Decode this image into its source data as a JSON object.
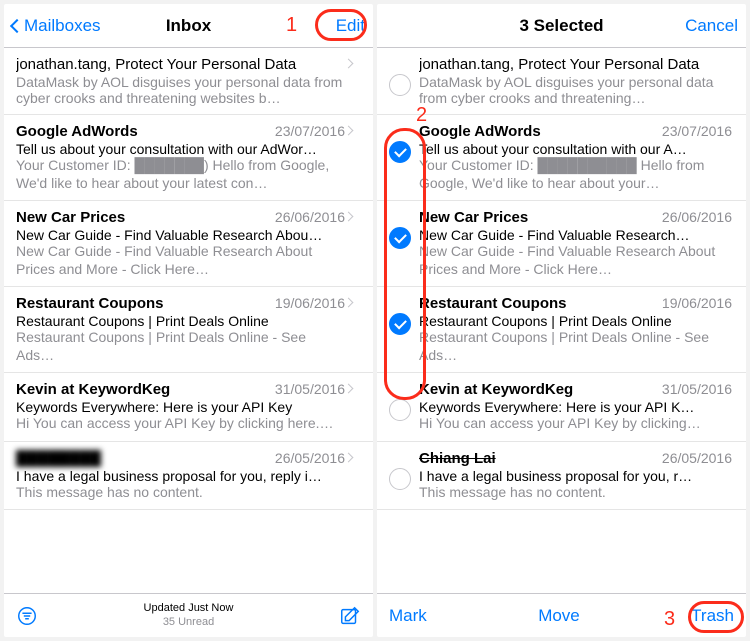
{
  "left": {
    "back_label": "Mailboxes",
    "title": "Inbox",
    "edit_label": "Edit",
    "status_line1": "Updated Just Now",
    "status_line2": "35 Unread",
    "messages": [
      {
        "sender": "jonathan.tang, Protect Your Personal Data",
        "sender_weight": "normal",
        "date": "",
        "subject": "DataMask by AOL disguises your personal data from cyber crooks and threatening websites b…",
        "preview": ""
      },
      {
        "sender": "Google AdWords",
        "date": "23/07/2016",
        "subject": "Tell us about your consultation with our AdWor…",
        "preview": "Your Customer ID: ███████) Hello from Google, We'd like to hear about your latest con…",
        "mask": true
      },
      {
        "sender": "New Car Prices",
        "date": "26/06/2016",
        "subject": "New Car Guide - Find Valuable Research Abou…",
        "preview": "New Car Guide - Find Valuable Research About Prices and More - Click Here…"
      },
      {
        "sender": "Restaurant Coupons",
        "date": "19/06/2016",
        "subject": "Restaurant Coupons | Print Deals Online",
        "preview": "Restaurant Coupons | Print Deals Online - See Ads…"
      },
      {
        "sender": "Kevin at KeywordKeg",
        "date": "31/05/2016",
        "subject": "Keywords Everywhere: Here is your API Key",
        "preview": "Hi\nYou can access your API Key by clicking here.…"
      },
      {
        "sender": "████████",
        "date": "26/05/2016",
        "subject": "I have a legal business proposal for you, reply i…",
        "preview": "This message has no content.",
        "blur_sender": true
      }
    ]
  },
  "right": {
    "title": "3 Selected",
    "cancel_label": "Cancel",
    "mark_label": "Mark",
    "move_label": "Move",
    "trash_label": "Trash",
    "messages": [
      {
        "checked": false,
        "sender": "jonathan.tang, Protect Your Personal Data",
        "sender_weight": "normal",
        "date": "",
        "subject": "DataMask by AOL disguises your personal data from cyber crooks and threatening…",
        "preview": ""
      },
      {
        "checked": true,
        "sender": "Google AdWords",
        "date": "23/07/2016",
        "subject": "Tell us about your consultation with our A…",
        "preview": "Your Customer ID: ██████████ Hello from Google, We'd like to hear about your…",
        "mask": true
      },
      {
        "checked": true,
        "sender": "New Car Prices",
        "date": "26/06/2016",
        "subject": "New Car Guide - Find Valuable Research…",
        "preview": "New Car Guide - Find Valuable Research About Prices and More - Click Here…"
      },
      {
        "checked": true,
        "sender": "Restaurant Coupons",
        "date": "19/06/2016",
        "subject": "Restaurant Coupons | Print Deals Online",
        "preview": "Restaurant Coupons | Print Deals Online - See Ads…"
      },
      {
        "checked": false,
        "sender": "Kevin at KeywordKeg",
        "date": "31/05/2016",
        "subject": "Keywords Everywhere: Here is your API K…",
        "preview": "Hi\nYou can access your API Key by clicking…"
      },
      {
        "checked": false,
        "sender": "Chiang Lai",
        "date": "26/05/2016",
        "subject": "I have a legal business proposal for you, r…",
        "preview": "This message has no content.",
        "strike_sender": true
      }
    ]
  },
  "annotations": {
    "n1": "1",
    "n2": "2",
    "n3": "3"
  }
}
